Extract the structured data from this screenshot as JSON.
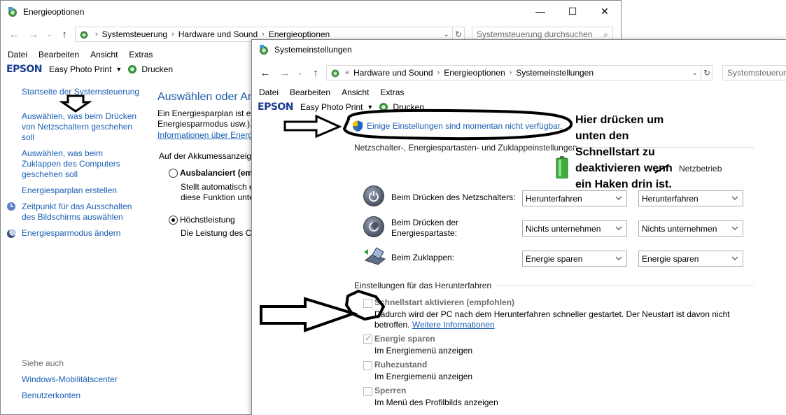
{
  "back_window": {
    "title": "Energieoptionen",
    "controls": {
      "minimize": "—",
      "maximize": "☐",
      "close": "✕"
    },
    "address": {
      "segments": [
        "Systemsteuerung",
        "Hardware und Sound",
        "Energieoptionen"
      ]
    },
    "search_placeholder": "Systemsteuerung durchsuchen",
    "menu": [
      "Datei",
      "Bearbeiten",
      "Ansicht",
      "Extras"
    ],
    "epson": {
      "logo": "EPSON",
      "app": "Easy Photo Print",
      "print": "Drucken"
    },
    "sidebar": {
      "items": [
        "Startseite der Systemsteuerung",
        "Auswählen, was beim Drücken von Netzschaltern geschehen soll",
        "Auswählen, was beim Zuklappen des Computers geschehen soll",
        "Energiesparplan erstellen",
        "Zeitpunkt für das Ausschalten des Bildschirms auswählen",
        "Energiesparmodus ändern"
      ],
      "see_also_label": "Siehe auch",
      "see_also": [
        "Windows-Mobilitätscenter",
        "Benutzerkonten"
      ]
    },
    "main": {
      "heading": "Auswählen oder An",
      "intro_line1": "Ein Energiesparplan ist ei",
      "intro_line2": "Energiesparmodus usw.),",
      "intro_link": "Informationen über Energ",
      "battery_label": "Auf der Akkumessanzeig",
      "plans": [
        {
          "name": "Ausbalanciert (emp",
          "desc1": "Stellt automatisch e",
          "desc2": "diese Funktion unte",
          "selected": false
        },
        {
          "name": "Höchstleistung",
          "desc1": "Die Leistung des Co",
          "desc2": "",
          "selected": true
        }
      ]
    }
  },
  "front_window": {
    "title": "Systemeinstellungen",
    "address": {
      "prefix": "«",
      "segments": [
        "Hardware und Sound",
        "Energieoptionen",
        "Systemeinstellungen"
      ]
    },
    "search_placeholder": "Systemsteuerun",
    "menu": [
      "Datei",
      "Bearbeiten",
      "Ansicht",
      "Extras"
    ],
    "epson": {
      "logo": "EPSON",
      "app": "Easy Photo Print",
      "print": "Drucken"
    },
    "unavailable_link": "Einige Einstellungen sind momentan nicht verfügbar.",
    "section_power_buttons": "Netzschalter-, Energiespartasten- und Zuklappeinstellungen",
    "column_header_right": "Netzbetrieb",
    "rows": [
      {
        "label1": "Beim Drücken des Netzschalters:",
        "label2": "",
        "battery": "Herunterfahren",
        "ac": "Herunterfahren"
      },
      {
        "label1": "Beim Drücken der",
        "label2": "Energiespartaste:",
        "battery": "Nichts unternehmen",
        "ac": "Nichts unternehmen"
      },
      {
        "label1": "Beim Zuklappen:",
        "label2": "",
        "battery": "Energie sparen",
        "ac": "Energie sparen"
      }
    ],
    "section_shutdown": "Einstellungen für das Herunterfahren",
    "shutdown_options": [
      {
        "title": "Schnellstart aktivieren (empfohlen)",
        "desc1": "Dadurch wird der PC nach dem Herunterfahren schneller gestartet. Der Neustart ist davon nicht",
        "desc2": "betroffen.",
        "link": "Weitere Informationen",
        "checked": false
      },
      {
        "title": "Energie sparen",
        "desc1": "Im Energiemenü anzeigen",
        "checked": true
      },
      {
        "title": "Ruhezustand",
        "desc1": "Im Energiemenü anzeigen",
        "checked": false
      },
      {
        "title": "Sperren",
        "desc1": "Im Menü des Profilbilds anzeigen",
        "checked": false
      }
    ]
  },
  "annotation": {
    "lines": [
      "Hier drücken um",
      "unten den",
      "Schnellstart zu",
      "deaktivieren wenn",
      "ein Haken drin ist."
    ]
  }
}
